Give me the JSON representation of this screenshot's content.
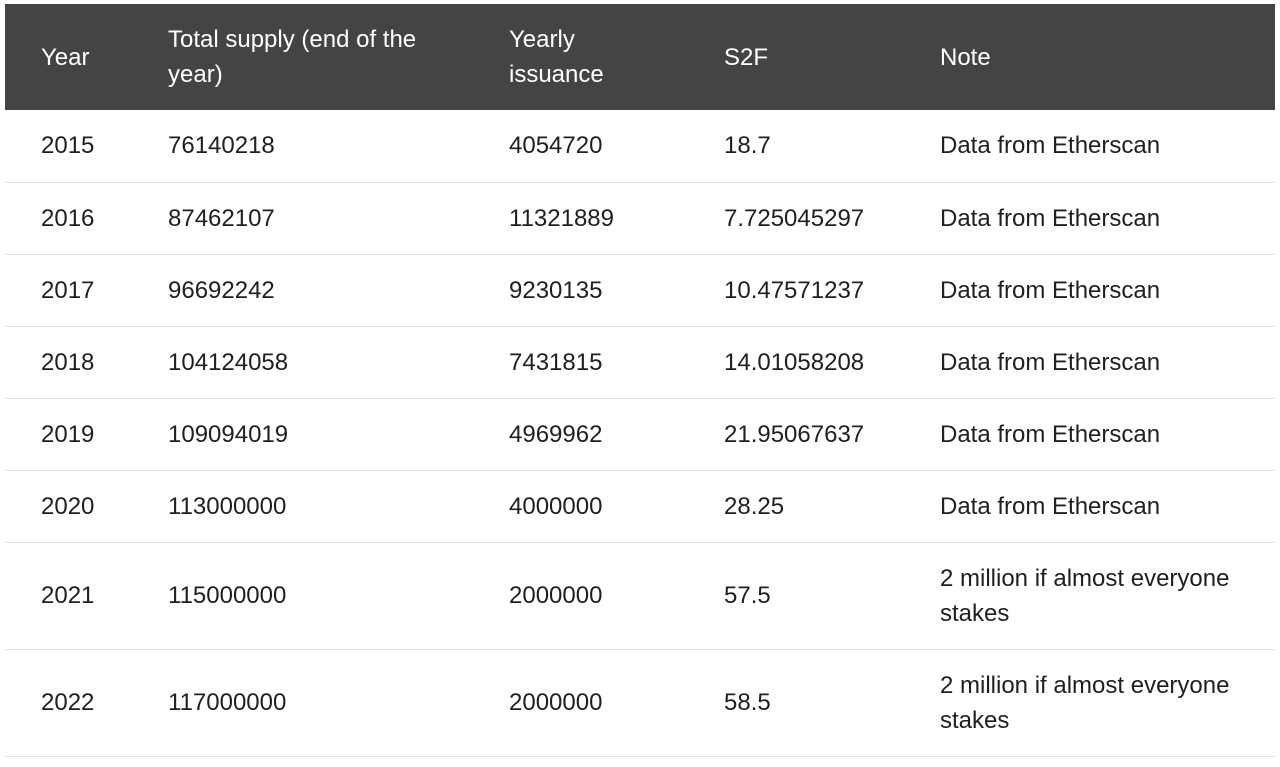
{
  "table": {
    "headers": [
      "Year",
      "Total supply (end of the year)",
      "Yearly issuance",
      "S2F",
      "Note"
    ],
    "rows": [
      [
        "2015",
        "76140218",
        "4054720",
        "18.7",
        "Data from Etherscan"
      ],
      [
        "2016",
        "87462107",
        "11321889",
        "7.725045297",
        "Data from Etherscan"
      ],
      [
        "2017",
        "96692242",
        "9230135",
        "10.47571237",
        "Data from Etherscan"
      ],
      [
        "2018",
        "104124058",
        "7431815",
        "14.01058208",
        "Data from Etherscan"
      ],
      [
        "2019",
        "109094019",
        "4969962",
        "21.95067637",
        "Data from Etherscan"
      ],
      [
        "2020",
        "113000000",
        "4000000",
        "28.25",
        "Data from Etherscan"
      ],
      [
        "2021",
        "115000000",
        "2000000",
        "57.5",
        "2 million if almost everyone stakes"
      ],
      [
        "2022",
        "117000000",
        "2000000",
        "58.5",
        "2 million if almost everyone stakes"
      ]
    ]
  },
  "colors": {
    "header_background": "#444444",
    "header_text": "#ffffff",
    "row_divider": "#e3e3e3"
  }
}
